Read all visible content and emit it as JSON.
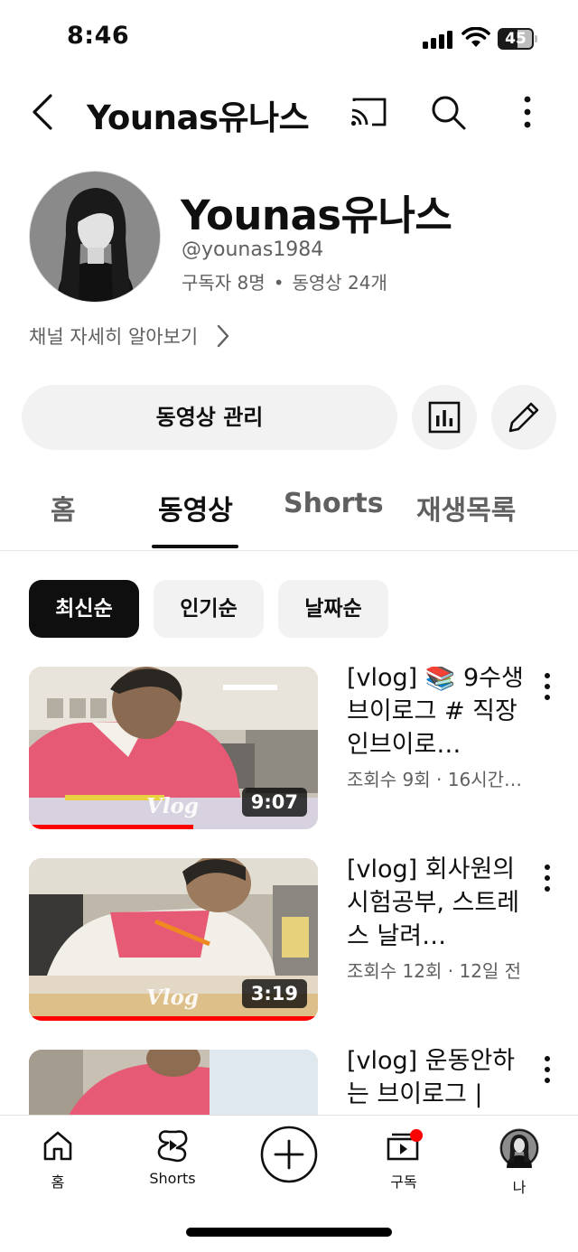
{
  "status_bar": {
    "time": "8:46",
    "battery": "45"
  },
  "header": {
    "title": "Younas유나스",
    "icons": [
      "back-icon",
      "cast-icon",
      "search-icon",
      "more-vert-icon"
    ]
  },
  "channel": {
    "name": "Younas유나스",
    "handle": "@younas1984",
    "subscribers": "구독자 8명",
    "separator": "•",
    "videos": "동영상 24개",
    "more_info": "채널 자세히 알아보기"
  },
  "actions": {
    "manage_videos": "동영상 관리",
    "icons": [
      "analytics-icon",
      "edit-pencil-icon"
    ]
  },
  "tabs": [
    {
      "label": "홈",
      "active": false
    },
    {
      "label": "동영상",
      "active": true
    },
    {
      "label": "Shorts",
      "active": false
    },
    {
      "label": "재생목록",
      "active": false
    }
  ],
  "chips": [
    {
      "label": "최신순",
      "selected": true
    },
    {
      "label": "인기순",
      "selected": false
    },
    {
      "label": "날짜순",
      "selected": false
    }
  ],
  "videos": [
    {
      "title": "[vlog] 📚 9수생 브이로그 # 직장인브이로…",
      "meta": "조회수 9회 · 16시간…",
      "duration": "9:07",
      "watermark": "Vlog",
      "watched_fraction": 0.57
    },
    {
      "title": "[vlog] 회사원의 시험공부, 스트레스 날려…",
      "meta": "조회수 12회 · 12일 전",
      "duration": "3:19",
      "watermark": "Vlog",
      "watched_fraction": 1.0
    },
    {
      "title": "[vlog] 운동안하는 브이로그 |",
      "meta": "",
      "duration": "",
      "watermark": "",
      "watched_fraction": 0
    }
  ],
  "bottom_nav": [
    {
      "label": "홈",
      "icon": "home-icon"
    },
    {
      "label": "Shorts",
      "icon": "shorts-icon"
    },
    {
      "label": "",
      "icon": "create-plus-icon"
    },
    {
      "label": "구독",
      "icon": "subscriptions-icon"
    },
    {
      "label": "나",
      "icon": "profile-avatar-icon"
    }
  ],
  "colors": {
    "accent_red": "#ff0000",
    "chip_selected": "#0f0f0f",
    "secondary_text": "#606060",
    "button_bg": "#f2f2f2"
  }
}
